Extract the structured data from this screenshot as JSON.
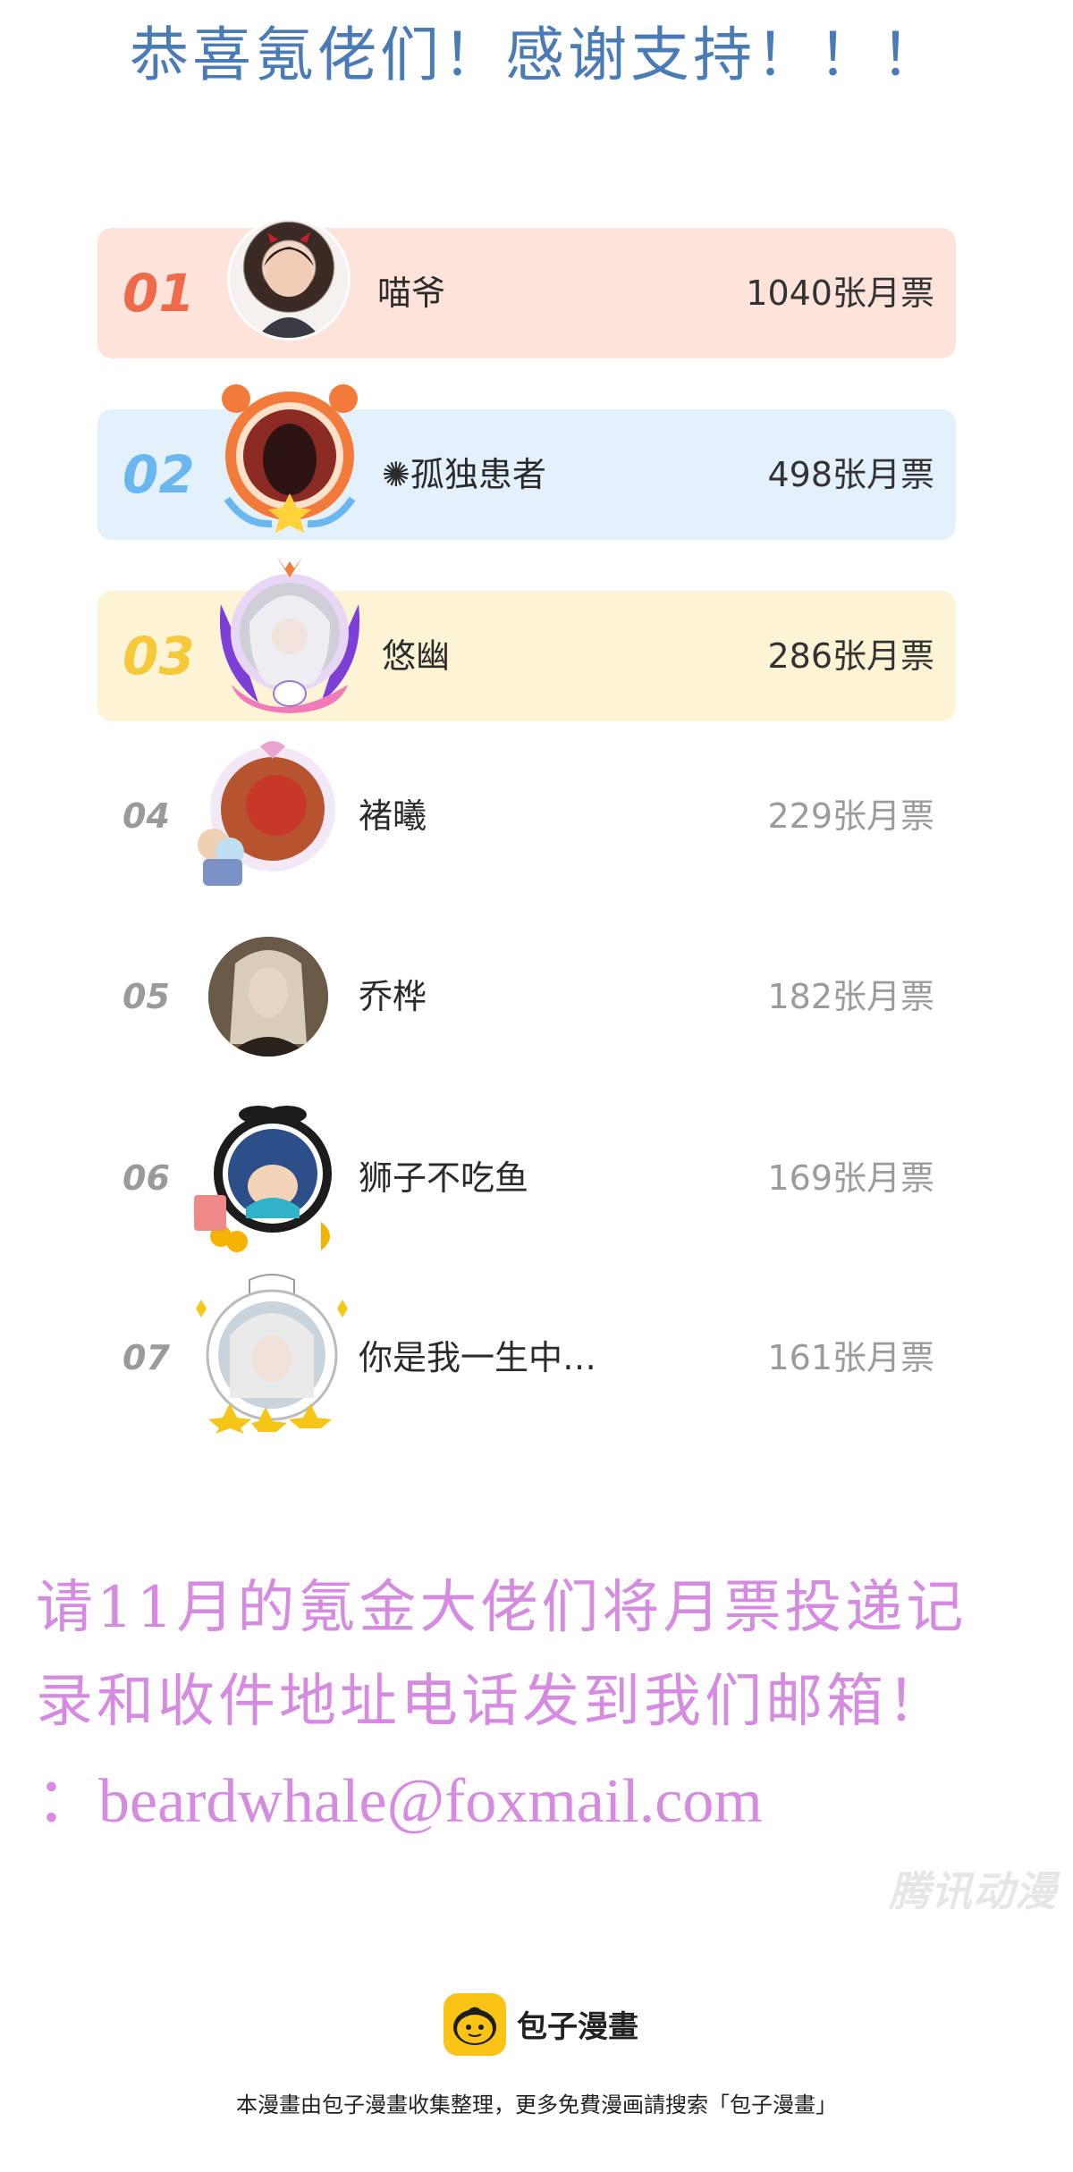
{
  "header": {
    "title": "恭喜氪佬们！感谢支持！！！"
  },
  "colors": {
    "title": "#4a7bb5",
    "row1_bg": "#fde3da",
    "row1_rank": "#ee6a4a",
    "row2_bg": "#e3f1fd",
    "row2_rank": "#6ab7f0",
    "row3_bg": "#fdf4d5",
    "row3_rank": "#f5c93a",
    "notice": "#d48be0",
    "brand_logo": "#fbc315"
  },
  "ranking": [
    {
      "rank": "01",
      "name": "喵爷",
      "votes": "1040张月票"
    },
    {
      "rank": "02",
      "name": "✺孤独患者",
      "votes": "498张月票"
    },
    {
      "rank": "03",
      "name": "悠幽",
      "votes": "286张月票"
    },
    {
      "rank": "04",
      "name": "褚曦",
      "votes": "229张月票"
    },
    {
      "rank": "05",
      "name": "乔桦",
      "votes": "182张月票"
    },
    {
      "rank": "06",
      "name": "狮子不吃鱼",
      "votes": "169张月票"
    },
    {
      "rank": "07",
      "name": "你是我一生中…",
      "votes": "161张月票"
    }
  ],
  "notice": {
    "line1": "请11月的氪金大佬们将月票投递记",
    "line2": "录和收件地址电话发到我们邮箱！",
    "email": "：beardwhale@foxmail.com"
  },
  "watermark": "腾讯动漫",
  "footer": {
    "brand": "包子漫畫",
    "note": "本漫畫由包子漫畫收集整理，更多免費漫画請搜索「包子漫畫」"
  }
}
